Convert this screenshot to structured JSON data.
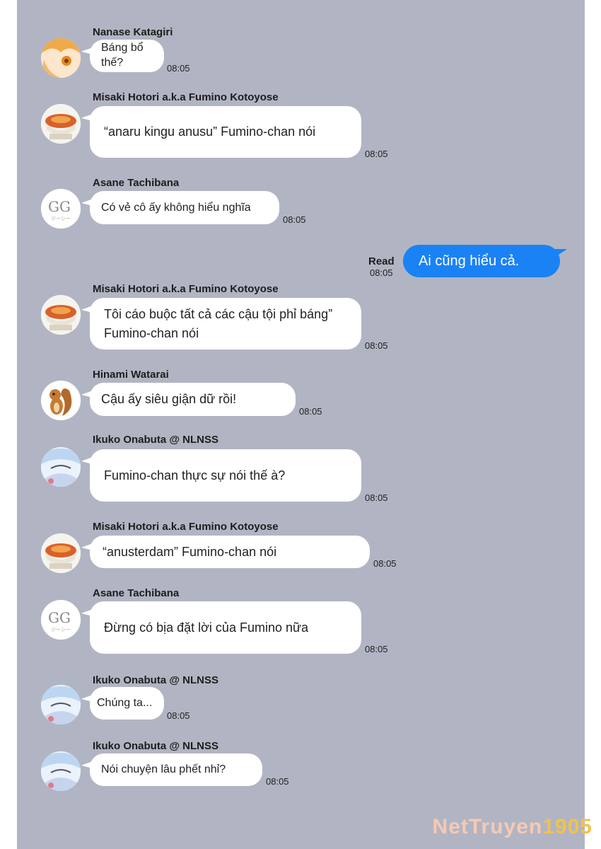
{
  "messages": [
    {
      "sender": "Nanase Katagiri",
      "text": "Báng bổ\nthế?",
      "time": "08:05",
      "avatar": "nanase-avatar"
    },
    {
      "sender": "Misaki Hotori a.k.a Fumino Kotoyose",
      "text": "“anaru kingu anusu” Fumino-chan nói",
      "time": "08:05",
      "avatar": "food-bowl-avatar"
    },
    {
      "sender": "Asane Tachibana",
      "text": "Có vẻ cô ấy không hiểu nghĩa",
      "time": "08:05",
      "avatar": "gg-avatar"
    },
    {
      "sender": "Misaki Hotori a.k.a Fumino Kotoyose",
      "text": "Tôi cáo buộc tất cả các cậu tội phỉ báng” Fumino-chan nói",
      "time": "08:05",
      "avatar": "food-bowl-avatar"
    },
    {
      "sender": "Hinami Watarai",
      "text": "Cậu ấy siêu giận dữ rồi!",
      "time": "08:05",
      "avatar": "squirrel-avatar"
    },
    {
      "sender": "Ikuko Onabuta @ NLNSS",
      "text": "Fumino-chan thực sự nói thế à?",
      "time": "08:05",
      "avatar": "ikuko-avatar"
    },
    {
      "sender": "Misaki Hotori a.k.a Fumino Kotoyose",
      "text": "“anusterdam” Fumino-chan nói",
      "time": "08:05",
      "avatar": "food-bowl-avatar"
    },
    {
      "sender": "Asane Tachibana",
      "text": "Đừng có bịa đặt lời của Fumino nữa",
      "time": "08:05",
      "avatar": "gg-avatar"
    },
    {
      "sender": "Ikuko Onabuta @ NLNSS",
      "text": "Chúng ta...",
      "time": "08:05",
      "avatar": "ikuko-avatar"
    },
    {
      "sender": "Ikuko Onabuta @ NLNSS",
      "text": "Nói chuyện lâu phết nhỉ?",
      "time": "08:05",
      "avatar": "ikuko-avatar"
    }
  ],
  "own_message": {
    "text": "Ai cũng hiểu cả.",
    "read_label": "Read",
    "time": "08:05"
  },
  "watermark": {
    "prefix": "NetTruyen",
    "suffix": "1905"
  },
  "colors": {
    "panel": "#b1b5c3",
    "own_bubble": "#1a82f5",
    "other_bubble": "#ffffff"
  }
}
